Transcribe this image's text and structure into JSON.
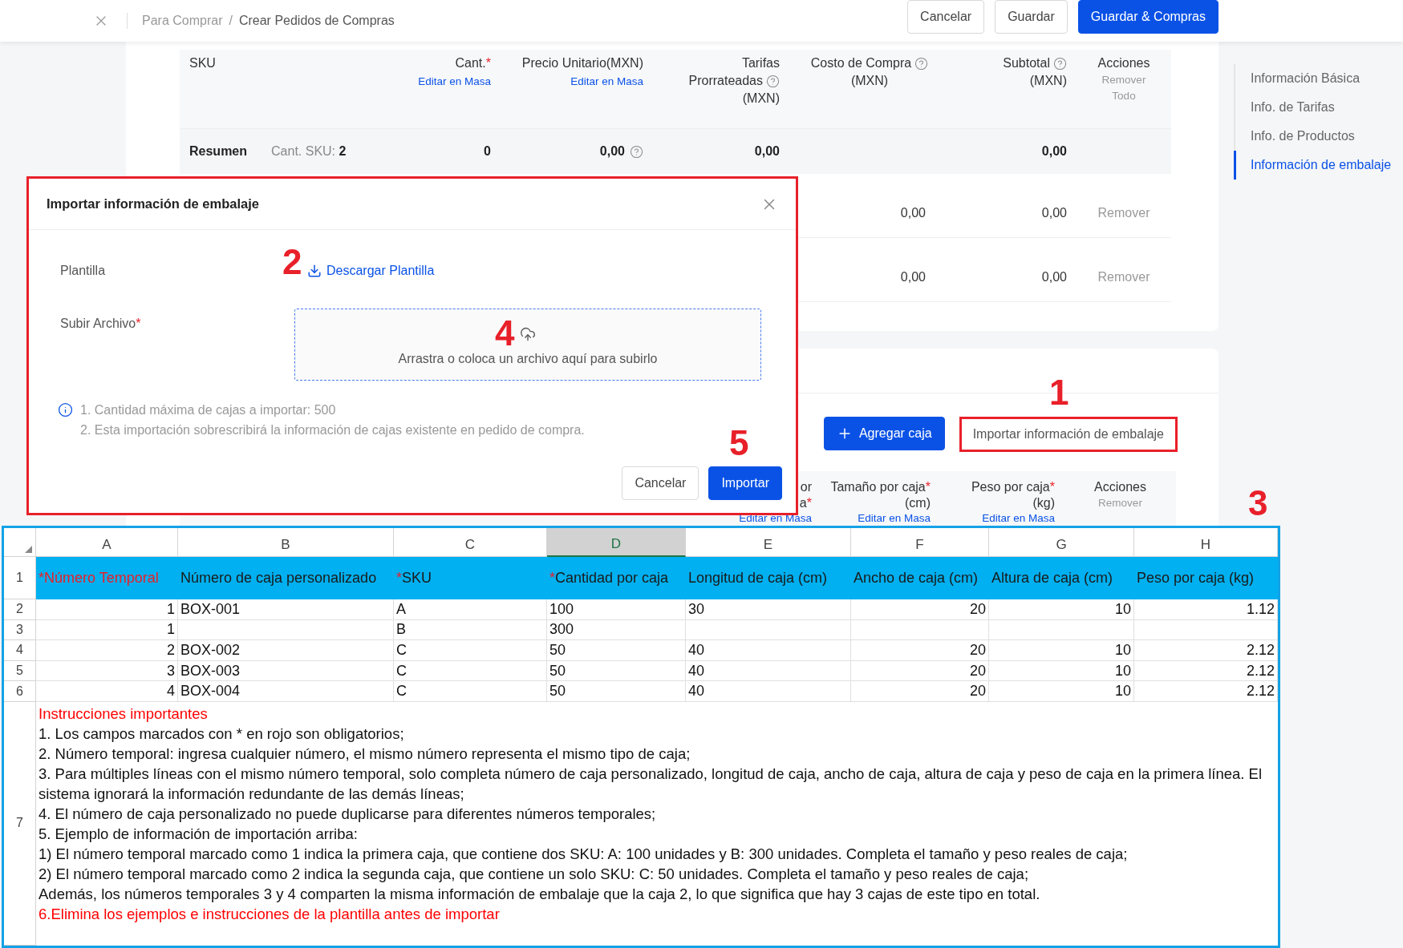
{
  "topbar": {
    "breadcrumb": [
      "Para Comprar",
      "Crear Pedidos de Compras"
    ],
    "separator": "/",
    "buttons": [
      {
        "label": "Cancelar",
        "kind": "default"
      },
      {
        "label": "Guardar",
        "kind": "default"
      },
      {
        "label": "Guardar & Compras",
        "kind": "primary"
      }
    ]
  },
  "sku_table": {
    "columns": [
      {
        "lines": [
          {
            "text": "SKU"
          }
        ]
      },
      {
        "lines": [
          {
            "text": "Cant.",
            "required_mark": "*"
          }
        ],
        "bulk_edit": "Editar en Masa"
      },
      {
        "lines": [
          {
            "text": "Precio Unitario(MXN)"
          }
        ],
        "bulk_edit": "Editar en Masa"
      },
      {
        "lines": [
          {
            "text": "Tarifas"
          },
          {
            "text": "Prorrateadas",
            "help": true
          },
          {
            "text": "(MXN)"
          }
        ]
      },
      {
        "lines": [
          {
            "text": "Costo de Compra",
            "help": true
          },
          {
            "text": "(MXN)"
          }
        ]
      },
      {
        "lines": [
          {
            "text": "Subtotal",
            "help": true
          },
          {
            "text": "(MXN)"
          }
        ]
      },
      {
        "lines": [
          {
            "text": "Acciones"
          }
        ],
        "sub_action": "Remover Todo"
      }
    ],
    "summary": {
      "label": "Resumen",
      "sku_count_label": "Cant. SKU:",
      "sku_count": "2",
      "qty": "0",
      "unit_price": "0,00",
      "unit_price_help": true,
      "fees": "0,00",
      "subtotal": "0,00"
    },
    "rows": [
      {
        "cost": "0,00",
        "subtotal": "0,00",
        "action": "Remover"
      },
      {
        "cost": "0,00",
        "subtotal": "0,00",
        "action": "Remover"
      }
    ]
  },
  "side_nav": {
    "items": [
      {
        "label": "Información Básica",
        "selected": false
      },
      {
        "label": "Info. de Tarifas",
        "selected": false
      },
      {
        "label": "Info. de Productos",
        "selected": false
      },
      {
        "label": "Información de embalaje",
        "selected": true
      }
    ]
  },
  "boxes": {
    "add_button": "Agregar caja",
    "import_button": "Importar información de embalaje",
    "columns": [
      {
        "lines": [
          {
            "text": "or"
          },
          {
            "text": "a",
            "required_mark": "*"
          }
        ],
        "bulk_edit": "Editar en Masa"
      },
      {
        "lines": [
          {
            "text": "Tamaño por caja",
            "required_mark": "*"
          },
          {
            "text": "(cm)"
          }
        ],
        "bulk_edit": "Editar en Masa"
      },
      {
        "lines": [
          {
            "text": "Peso por caja",
            "required_mark": "*"
          },
          {
            "text": "(kg)"
          }
        ],
        "bulk_edit": "Editar en Masa"
      },
      {
        "lines": [
          {
            "text": "Acciones"
          }
        ],
        "sub_action": "Remover"
      }
    ]
  },
  "modal": {
    "title": "Importar información de embalaje",
    "template_label": "Plantilla",
    "download_link": "Descargar Plantilla",
    "upload_label": "Subir Archivo",
    "upload_required_mark": "*",
    "dropzone_text": "Arrastra o coloca un archivo aquí para subirlo",
    "notes": [
      "1. Cantidad máxima de cajas a importar: 500",
      "2. Esta importación sobrescribirá la información de cajas existente en pedido de compra."
    ],
    "buttons": [
      {
        "label": "Cancelar",
        "kind": "default"
      },
      {
        "label": "Importar",
        "kind": "primary"
      }
    ]
  },
  "spreadsheet": {
    "columns": [
      {
        "letter": "A",
        "selected": false
      },
      {
        "letter": "B",
        "selected": false
      },
      {
        "letter": "C",
        "selected": false
      },
      {
        "letter": "D",
        "selected": true
      },
      {
        "letter": "E",
        "selected": false
      },
      {
        "letter": "F",
        "selected": false
      },
      {
        "letter": "G",
        "selected": false
      },
      {
        "letter": "H",
        "selected": false
      }
    ],
    "header_row": {
      "number": "1",
      "cells": [
        {
          "mark": "*",
          "text": "Número Temporal",
          "all_red": true
        },
        {
          "text": "Número de caja personalizado",
          "all_red": false
        },
        {
          "mark": "*",
          "text": "SKU",
          "all_red": false
        },
        {
          "mark": "*",
          "text": "Cantidad por caja",
          "all_red": false
        },
        {
          "text": "Longitud de caja (cm)",
          "all_red": false
        },
        {
          "text": "Ancho de caja (cm)",
          "all_red": false
        },
        {
          "text": "Altura de caja (cm)",
          "all_red": false
        },
        {
          "text": "Peso por caja (kg)",
          "all_red": false
        }
      ]
    },
    "rows": [
      {
        "number": "2",
        "cells": [
          {
            "text": "1"
          },
          {
            "text": "BOX-001"
          },
          {
            "text": "A"
          },
          {
            "text": "100"
          },
          {
            "text": "30"
          },
          {
            "text": "20"
          },
          {
            "text": "10"
          },
          {
            "text": "1.12"
          }
        ]
      },
      {
        "number": "3",
        "cells": [
          {
            "text": "1"
          },
          {},
          {
            "text": "B"
          },
          {
            "text": "300"
          },
          {},
          {},
          {},
          {}
        ]
      },
      {
        "number": "4",
        "cells": [
          {
            "text": "2"
          },
          {
            "text": "BOX-002"
          },
          {
            "text": "C"
          },
          {
            "text": "50"
          },
          {
            "text": "40"
          },
          {
            "text": "20"
          },
          {
            "text": "10"
          },
          {
            "text": "2.12"
          }
        ]
      },
      {
        "number": "5",
        "cells": [
          {
            "text": "3"
          },
          {
            "text": "BOX-003"
          },
          {
            "text": "C"
          },
          {
            "text": "50"
          },
          {
            "text": "40"
          },
          {
            "text": "20"
          },
          {
            "text": "10"
          },
          {
            "text": "2.12"
          }
        ]
      },
      {
        "number": "6",
        "cells": [
          {
            "text": "4"
          },
          {
            "text": "BOX-004"
          },
          {
            "text": "C"
          },
          {
            "text": "50"
          },
          {
            "text": "40"
          },
          {
            "text": "20"
          },
          {
            "text": "10"
          },
          {
            "text": "2.12"
          }
        ]
      }
    ],
    "notes_row": {
      "number": "7",
      "lines": [
        {
          "text": "Instrucciones importantes",
          "red": true
        },
        {
          "text": "1. Los campos marcados con * en rojo son obligatorios;",
          "red": false
        },
        {
          "text": "2. Número temporal: ingresa cualquier número, el mismo número representa el mismo tipo de caja;",
          "red": false
        },
        {
          "text": "3. Para múltiples líneas con el mismo número temporal, solo completa número de caja personalizado, longitud de caja, ancho de caja, altura de caja y peso de caja en la primera línea. El sistema ignorará la información redundante de las demás líneas;",
          "red": false
        },
        {
          "text": "4. El número de caja personalizado no puede duplicarse para diferentes números temporales;",
          "red": false
        },
        {
          "text": "5. Ejemplo de información de importación arriba:",
          "red": false
        },
        {
          "text": "1) El número temporal marcado como 1 indica la primera caja, que contiene dos SKU: A: 100 unidades y B: 300 unidades. Completa el tamaño y peso reales de caja;",
          "red": false
        },
        {
          "text": "2) El número temporal marcado como 2 indica la segunda caja, que contiene un solo SKU: C: 50 unidades. Completa el tamaño y peso reales de caja;",
          "red": false
        },
        {
          "text": "Además, los números temporales 3 y 4 comparten la misma información de embalaje que la caja 2, lo que significa que hay 3 cajas de este tipo en total.",
          "red": false
        },
        {
          "text": "6.Elimina los ejemplos e instrucciones de la plantilla antes de importar",
          "red": true
        }
      ]
    }
  },
  "annotations": [
    "1",
    "2",
    "3",
    "4",
    "5"
  ]
}
